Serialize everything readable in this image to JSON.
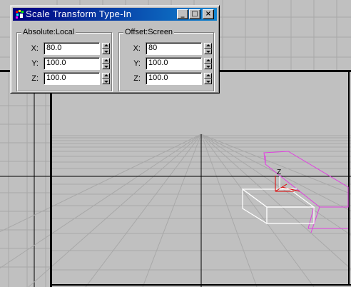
{
  "dialog": {
    "title": "Scale Transform Type-In",
    "icon": "3dsmax-app-icon",
    "caption_buttons": {
      "minimize": "_",
      "maximize": "□",
      "close": "×"
    },
    "absolute": {
      "label": "Absolute:Local",
      "rows": [
        {
          "axis": "X:",
          "value": "80.0"
        },
        {
          "axis": "Y:",
          "value": "100.0"
        },
        {
          "axis": "Z:",
          "value": "100.0"
        }
      ]
    },
    "offset": {
      "label": "Offset:Screen",
      "rows": [
        {
          "axis": "X:",
          "value": "80"
        },
        {
          "axis": "Y:",
          "value": "100.0"
        },
        {
          "axis": "Z:",
          "value": "100.0"
        }
      ]
    }
  },
  "viewport": {
    "gizmo_axis_label": "Z",
    "colors": {
      "background": "#c0c0c0",
      "grid": "#a8a8a8",
      "border": "#000000",
      "selected_object": "#ffffff",
      "other_object": "#e040e0",
      "gizmo": "#e00000"
    }
  }
}
